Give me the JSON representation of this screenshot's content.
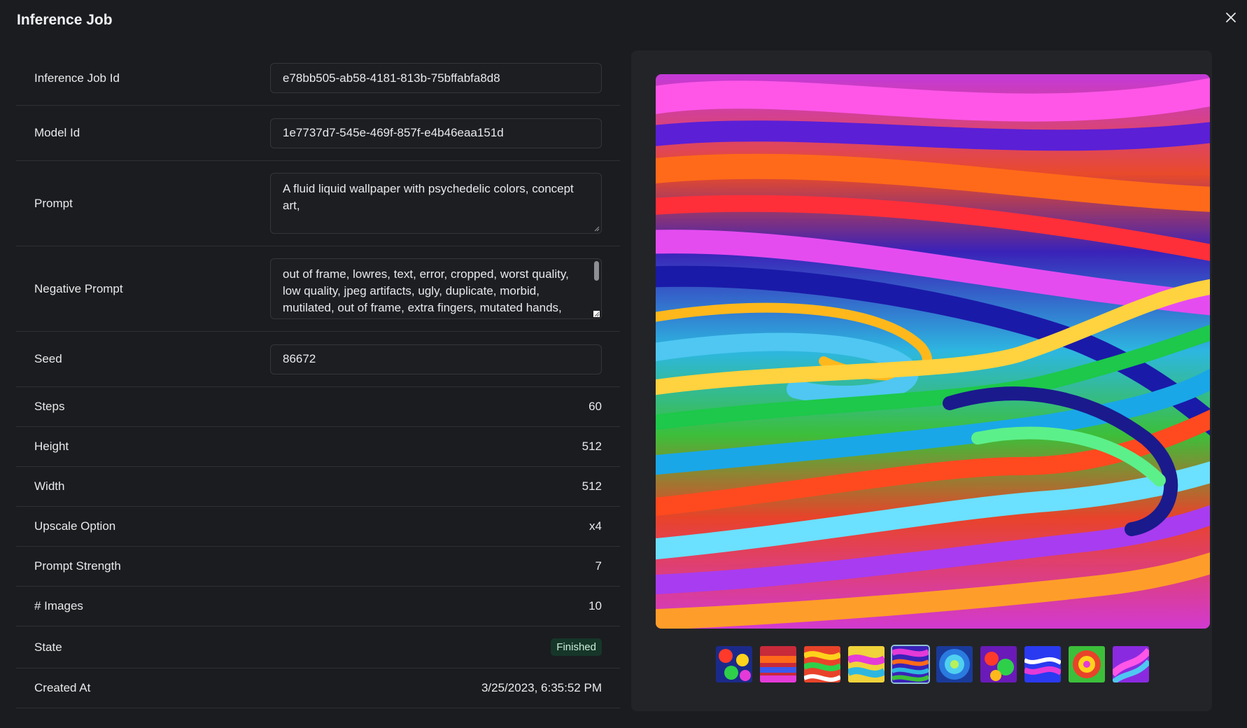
{
  "dialog": {
    "title": "Inference Job"
  },
  "fields": {
    "job_id": {
      "label": "Inference Job Id",
      "value": "e78bb505-ab58-4181-813b-75bffabfa8d8"
    },
    "model_id": {
      "label": "Model Id",
      "value": "1e7737d7-545e-469f-857f-e4b46eaa151d"
    },
    "prompt": {
      "label": "Prompt",
      "value": "A fluid liquid wallpaper with psychedelic colors, concept art,"
    },
    "negative_prompt": {
      "label": "Negative Prompt",
      "value": "out of frame, lowres, text, error, cropped, worst quality, low quality, jpeg artifacts, ugly, duplicate, morbid, mutilated, out of frame, extra fingers, mutated hands,"
    },
    "seed": {
      "label": "Seed",
      "value": "86672"
    },
    "steps": {
      "label": "Steps",
      "value": "60"
    },
    "height": {
      "label": "Height",
      "value": "512"
    },
    "width": {
      "label": "Width",
      "value": "512"
    },
    "upscale": {
      "label": "Upscale Option",
      "value": "x4"
    },
    "prompt_strength": {
      "label": "Prompt Strength",
      "value": "7"
    },
    "images": {
      "label": "# Images",
      "value": "10"
    },
    "state": {
      "label": "State",
      "value": "Finished"
    },
    "created_at": {
      "label": "Created At",
      "value": "3/25/2023, 6:35:52 PM"
    }
  },
  "colors": {
    "background": "#1b1c1f",
    "panel": "#232428",
    "badge_bg": "#16362a",
    "badge_text": "#ccecd9",
    "selected_thumb": "#8fc3d4"
  },
  "icons": {
    "close": "close-icon"
  },
  "gallery": {
    "selected_index": 4,
    "thumbnail_count": 10
  }
}
